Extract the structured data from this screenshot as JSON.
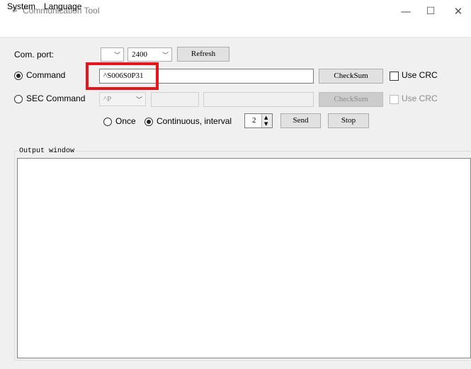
{
  "window": {
    "title": "Communication Tool",
    "icon": "antenna-icon"
  },
  "titlebar_buttons": {
    "minimize": "—",
    "maximize": "☐",
    "close": "✕"
  },
  "menu": {
    "system": "System",
    "language": "Language"
  },
  "com_port": {
    "label": "Com. port:",
    "port_value": "",
    "baud_value": "2400",
    "refresh": "Refresh"
  },
  "command": {
    "label": "Command",
    "value": "^S006S0P31",
    "checksum": "CheckSum",
    "use_crc": "Use CRC",
    "selected": true
  },
  "sec_command": {
    "label": "SEC Command",
    "prefix": "^P",
    "field1": "",
    "field2": "",
    "checksum": "CheckSum",
    "use_crc": "Use CRC",
    "selected": false
  },
  "mode": {
    "once": "Once",
    "continuous": "Continuous, interval",
    "interval": "2",
    "send": "Send",
    "stop": "Stop",
    "selected": "continuous"
  },
  "output": {
    "legend": "Output window",
    "content": ""
  },
  "colors": {
    "highlight": "#e8141c",
    "background": "#f0f0f0"
  }
}
